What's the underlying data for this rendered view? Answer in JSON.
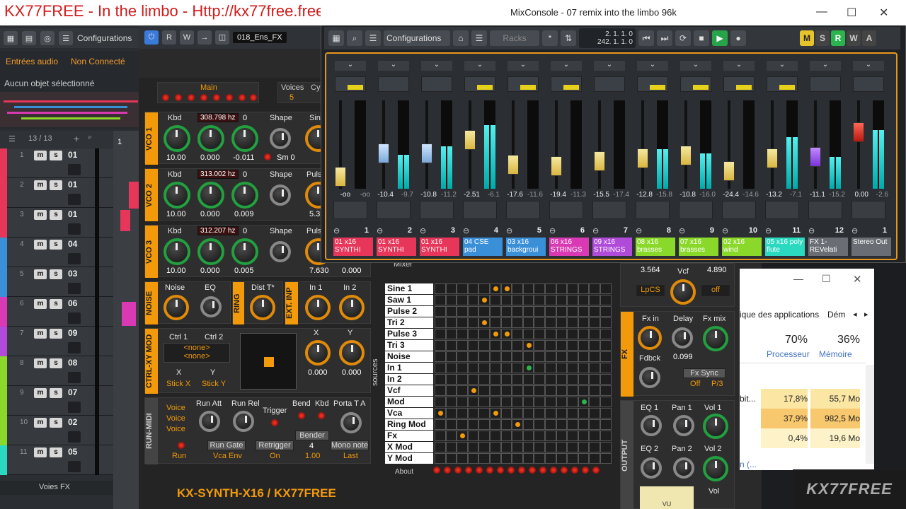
{
  "window_title": "KX77FREE - In the limbo - Http://kx77free.free.fr",
  "cubase": {
    "toolbar": {
      "configurations": "Configurations"
    },
    "inspector": {
      "tab1": "Entrées audio",
      "tab2": "Non Connecté",
      "no_selection": "Aucun objet sélectionné"
    },
    "tracklist": {
      "count": "13 / 13"
    },
    "tracks": [
      {
        "n": "1",
        "name": "01",
        "color": "#e8365a"
      },
      {
        "n": "2",
        "name": "01",
        "color": "#e8365a"
      },
      {
        "n": "3",
        "name": "01",
        "color": "#e8365a"
      },
      {
        "n": "4",
        "name": "04",
        "color": "#3a8fd9"
      },
      {
        "n": "5",
        "name": "03",
        "color": "#3a8fd9"
      },
      {
        "n": "6",
        "name": "06",
        "color": "#d93ab4"
      },
      {
        "n": "7",
        "name": "09",
        "color": "#b04ad9"
      },
      {
        "n": "8",
        "name": "08",
        "color": "#8ad92a"
      },
      {
        "n": "9",
        "name": "07",
        "color": "#8ad92a"
      },
      {
        "n": "10",
        "name": "02",
        "color": "#8ad92a"
      },
      {
        "n": "11",
        "name": "05",
        "color": "#2ad9c0"
      }
    ],
    "voies_fx": "Voies FX",
    "arrange_marker": "1"
  },
  "synth": {
    "top": {
      "preset": "018_Ens_FX"
    },
    "main": "Main",
    "voices": {
      "label": "Voices",
      "value": "5",
      "cy": "Cy"
    },
    "vco1": {
      "tag": "VCO 1",
      "kbd": "Kbd",
      "hz": "308.798 hz",
      "v0": "0",
      "shape": "Shape",
      "sin": "Sin",
      "vals": [
        "10.00",
        "0.000",
        "-0.011",
        "Sm 0"
      ]
    },
    "vco2": {
      "tag": "VCO 2",
      "kbd": "Kbd",
      "hz": "313.002 hz",
      "v0": "0",
      "shape": "Shape",
      "pulse": "Pulse",
      "vals": [
        "10.00",
        "0.000",
        "0.009",
        "5.31"
      ]
    },
    "vco3": {
      "tag": "VCO 3",
      "kbd": "Kbd",
      "hz": "312.207 hz",
      "v0": "0",
      "shape": "Shape",
      "pulse": "Pulse",
      "vals": [
        "10.00",
        "0.000",
        "0.005",
        "7.630",
        "0.000"
      ]
    },
    "noise": {
      "tag": "NOISE",
      "l1": "Noise",
      "l2": "EQ"
    },
    "ring": {
      "tag": "RING",
      "l1": "Dist T*"
    },
    "ext": {
      "tag": "EXT. INP",
      "l1": "In 1",
      "l2": "In 2"
    },
    "ctrl": {
      "tag": "CTRL-XY MOD",
      "c1": "Ctrl 1",
      "c2": "Ctrl 2",
      "n1": "<none>",
      "n2": "<none>",
      "x": "X",
      "y": "Y",
      "sx": "Stick X",
      "sy": "Stick Y",
      "kx": "X",
      "ky": "Y",
      "vx": "0.000",
      "vy": "0.000"
    },
    "runmidi": {
      "tag": "RUN-MIDI",
      "voices": [
        "Voice",
        "Voice",
        "Voice"
      ],
      "run_att": "Run Att",
      "run_rel": "Run Rel",
      "trigger": "Trigger",
      "bend": "Bend",
      "kbd": "Kbd",
      "porta": "Porta T A",
      "bender": "Bender",
      "run": "Run",
      "run_gate": "Run Gate",
      "vca_env": "Vca Env",
      "retrigger": "Retrigger",
      "on": "On",
      "bend_val": "4",
      "bend_val2": "1.00",
      "mono": "Mono note",
      "last": "Last"
    },
    "mixer_label": "Mixer",
    "sources_label": "sources",
    "matrix_rows": [
      "Sine 1",
      "Saw 1",
      "Pulse 2",
      "Tri 2",
      "Pulse 3",
      "Tri 3",
      "Noise",
      "In 1",
      "In 2",
      "Vcf",
      "Mod",
      "Vca",
      "Ring Mod",
      "Fx",
      "X Mod",
      "Y Mod"
    ],
    "about": "About",
    "brand": "KX-SYNTH-X16 / KX77FREE",
    "vcf": {
      "v1": "3.564",
      "label": "Vcf",
      "v2": "4.890",
      "lpcs": "LpCS",
      "off": "off"
    },
    "fx": {
      "tag": "FX",
      "fx_in": "Fx in",
      "delay": "Delay",
      "fx_mix": "Fx mix",
      "delay_val": "0.099",
      "fdbck": "Fdbck",
      "fx_sync": "Fx Sync",
      "off": "Off",
      "p3": "P/3"
    },
    "output": {
      "tag": "OUTPUT",
      "eq1": "EQ 1",
      "pan1": "Pan 1",
      "vol1": "Vol 1",
      "eq2": "EQ 2",
      "pan2": "Pan 2",
      "vol2": "Vol 2",
      "vol": "Vol",
      "vu": "VU"
    }
  },
  "mixconsole": {
    "title": "MixConsole - 07 remix into the limbo 96k",
    "configurations": "Configurations",
    "racks": "Racks",
    "pos1": "2. 1. 1.  0",
    "pos2": "242. 1. 1.  0",
    "msrw": [
      "M",
      "S",
      "R",
      "W",
      "A"
    ],
    "strips": [
      {
        "name": "01 x16 SYNTHI",
        "num": "1",
        "db1": "-oo",
        "db2": "-oo",
        "color": "#e8365a",
        "level": 0.15,
        "meter": 0,
        "cap": "yellow",
        "yellow": true
      },
      {
        "name": "01 x16 SYNTHI",
        "num": "2",
        "db1": "-10.4",
        "db2": "-9.7",
        "color": "#e8365a",
        "level": 0.45,
        "meter": 0.38,
        "cap": "blue",
        "yellow": false
      },
      {
        "name": "01 x16 SYNTHI",
        "num": "3",
        "db1": "-10.8",
        "db2": "-11.2",
        "color": "#e8365a",
        "level": 0.45,
        "meter": 0.48,
        "cap": "blue",
        "yellow": false
      },
      {
        "name": "04 CSE pad",
        "num": "4",
        "db1": "-2.51",
        "db2": "-6.1",
        "color": "#3a8fd9",
        "level": 0.62,
        "meter": 0.72,
        "cap": "yellow",
        "yellow": true
      },
      {
        "name": "03 x16 backgroui",
        "num": "5",
        "db1": "-17.6",
        "db2": "-11.6",
        "color": "#3a8fd9",
        "level": 0.3,
        "meter": 0.0,
        "cap": "yellow",
        "yellow": true
      },
      {
        "name": "06 x16 STRINGS",
        "num": "6",
        "db1": "-19.4",
        "db2": "-11.3",
        "color": "#d93ab4",
        "level": 0.28,
        "meter": 0.0,
        "cap": "yellow",
        "yellow": true
      },
      {
        "name": "09 x16 STRINGS",
        "num": "7",
        "db1": "-15.5",
        "db2": "-17.4",
        "color": "#b04ad9",
        "level": 0.35,
        "meter": 0.0,
        "cap": "yellow",
        "yellow": false
      },
      {
        "name": "08 x16 brasses",
        "num": "8",
        "db1": "-12.8",
        "db2": "-15.8",
        "color": "#8ad92a",
        "level": 0.38,
        "meter": 0.45,
        "cap": "yellow",
        "yellow": true
      },
      {
        "name": "07 x16 brasses",
        "num": "9",
        "db1": "-10.8",
        "db2": "-16.0",
        "color": "#8ad92a",
        "level": 0.42,
        "meter": 0.4,
        "cap": "yellow",
        "yellow": true
      },
      {
        "name": "02 x16 wind",
        "num": "10",
        "db1": "-24.4",
        "db2": "-14.6",
        "color": "#8ad92a",
        "level": 0.22,
        "meter": 0.0,
        "cap": "yellow",
        "yellow": true
      },
      {
        "name": "05 x16 poly flute",
        "num": "11",
        "db1": "-13.2",
        "db2": "-7.1",
        "color": "#2ad9c0",
        "level": 0.38,
        "meter": 0.58,
        "cap": "yellow",
        "yellow": true
      },
      {
        "name": "FX 1-REVelati",
        "num": "12",
        "db1": "-11.1",
        "db2": "-15.2",
        "color": "#6a6e74",
        "level": 0.4,
        "meter": 0.36,
        "cap": "purple",
        "yellow": false
      },
      {
        "name": "Stereo Out",
        "num": "1",
        "db1": "0.00",
        "db2": "-2.6",
        "color": "#6a6e74",
        "level": 0.72,
        "meter": 0.66,
        "cap": "red",
        "yellow": false
      }
    ]
  },
  "taskmgr": {
    "tab1": "ique des applications",
    "tab2": "Dém",
    "cpu_pct": "70%",
    "cpu": "Processeur",
    "mem_pct": "36%",
    "mem": "Mémoire",
    "rows": [
      {
        "name": "bit...",
        "cpu": "17,8%",
        "mem": "55,7 Mo"
      },
      {
        "name": "",
        "cpu": "37,9%",
        "mem": "982,5 Mo"
      },
      {
        "name": "",
        "cpu": "0,4%",
        "mem": "19,6 Mo"
      }
    ],
    "more": "n (..."
  },
  "logo": "KX77FREE"
}
